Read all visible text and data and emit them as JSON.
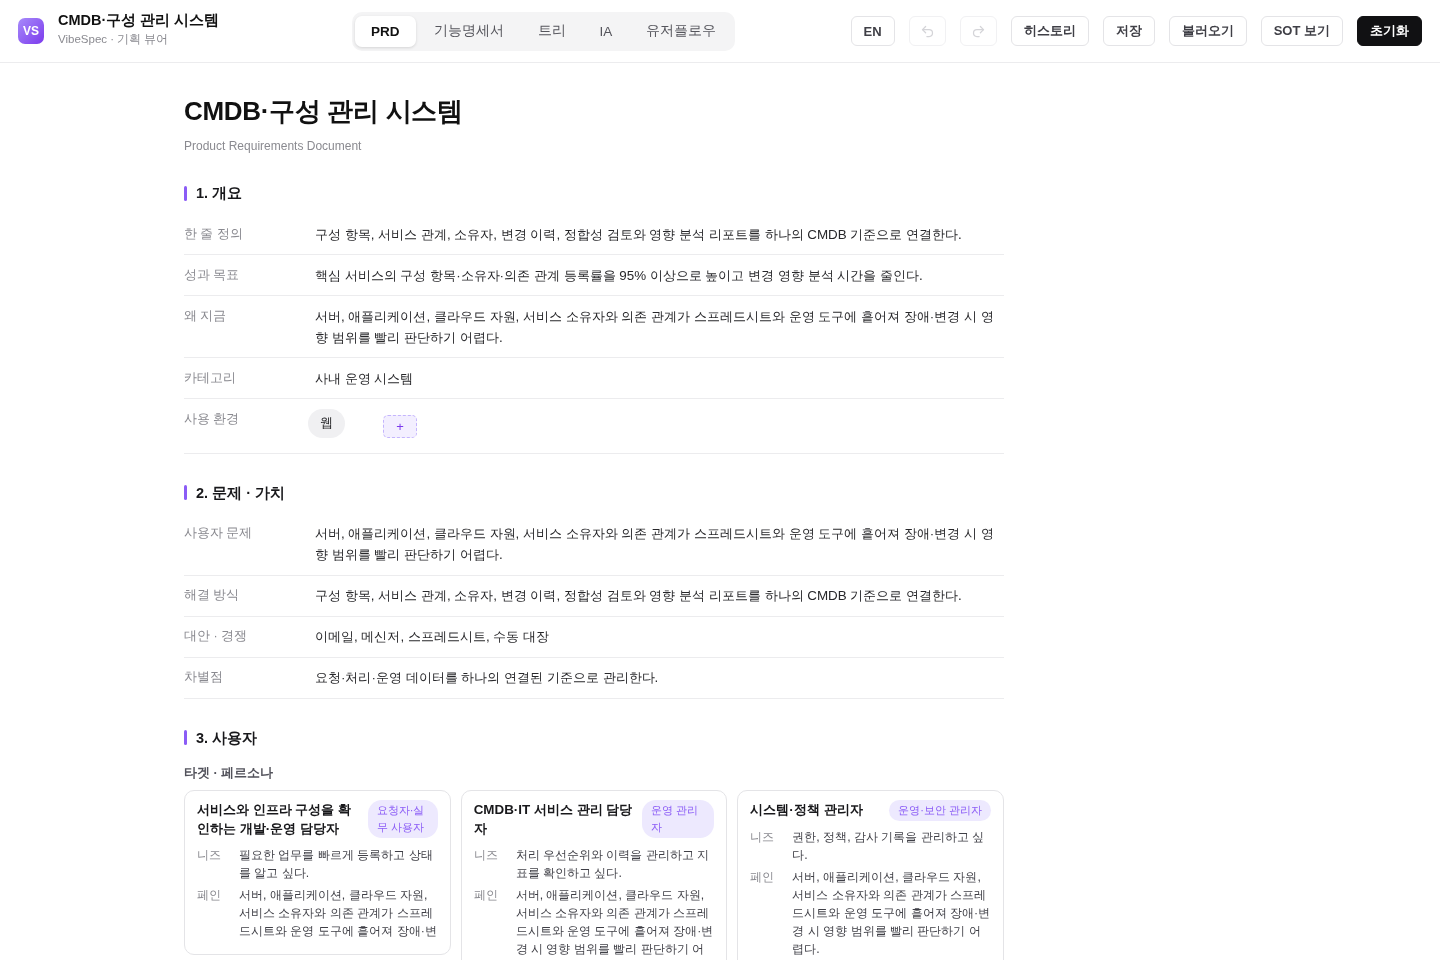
{
  "header": {
    "logo": "VS",
    "title": "CMDB·구성 관리 시스템",
    "subtitle": "VibeSpec · 기획 뷰어"
  },
  "tabs": [
    {
      "label": "PRD",
      "selected": true
    },
    {
      "label": "기능명세서",
      "selected": false
    },
    {
      "label": "트리",
      "selected": false
    },
    {
      "label": "IA",
      "selected": false
    },
    {
      "label": "유저플로우",
      "selected": false
    }
  ],
  "toolbar": [
    {
      "kind": "text",
      "label": "EN",
      "disabled": false
    },
    {
      "kind": "undo",
      "disabled": true
    },
    {
      "kind": "redo",
      "disabled": true
    },
    {
      "kind": "text",
      "label": "히스토리",
      "disabled": false
    },
    {
      "kind": "text",
      "label": "저장",
      "disabled": false
    },
    {
      "kind": "text",
      "label": "불러오기",
      "disabled": false
    },
    {
      "kind": "text",
      "label": "SOT 보기",
      "disabled": false
    },
    {
      "kind": "primary",
      "label": "초기화",
      "disabled": false
    }
  ],
  "document": {
    "title": "CMDB·구성 관리 시스템",
    "subtitle": "Product Requirements Document"
  },
  "sections": [
    {
      "kind": "fields",
      "heading": "1. 개요",
      "rows": [
        {
          "kind": "text",
          "label": "한 줄 정의",
          "value": "구성 항목, 서비스 관계, 소유자, 변경 이력, 정합성 검토와 영향 분석 리포트를 하나의 CMDB 기준으로 연결한다."
        },
        {
          "kind": "text",
          "label": "성과 목표",
          "value": "핵심 서비스의 구성 항목·소유자·의존 관계 등록률을 95% 이상으로 높이고 변경 영향 분석 시간을 줄인다."
        },
        {
          "kind": "text",
          "label": "왜 지금",
          "value": "서버, 애플리케이션, 클라우드 자원, 서비스 소유자와 의존 관계가 스프레드시트와 운영 도구에 흩어져 장애·변경 시 영향 범위를 빨리 판단하기 어렵다."
        },
        {
          "kind": "text",
          "label": "카테고리",
          "value": "사내 운영 시스템"
        },
        {
          "kind": "chips",
          "label": "사용 환경",
          "chips": [
            "웹"
          ],
          "add": "+"
        }
      ]
    },
    {
      "kind": "fields",
      "heading": "2. 문제 · 가치",
      "rows": [
        {
          "kind": "text",
          "label": "사용자 문제",
          "value": "서버, 애플리케이션, 클라우드 자원, 서비스 소유자와 의존 관계가 스프레드시트와 운영 도구에 흩어져 장애·변경 시 영향 범위를 빨리 판단하기 어렵다."
        },
        {
          "kind": "text",
          "label": "해결 방식",
          "value": "구성 항목, 서비스 관계, 소유자, 변경 이력, 정합성 검토와 영향 분석 리포트를 하나의 CMDB 기준으로 연결한다."
        },
        {
          "kind": "text",
          "label": "대안 · 경쟁",
          "value": "이메일, 메신저, 스프레드시트, 수동 대장"
        },
        {
          "kind": "text",
          "label": "차별점",
          "value": "요청·처리·운영 데이터를 하나의 연결된 기준으로 관리한다."
        }
      ]
    },
    {
      "kind": "personas",
      "heading": "3. 사용자",
      "subheading": "타겟 · 페르소나",
      "personas": [
        {
          "name": "서비스와 인프라 구성을 확인하는 개발·운영 담당자",
          "role": "요청자·실무 사용자",
          "needs_label": "니즈",
          "needs": "필요한 업무를 빠르게 등록하고 상태를 알고 싶다.",
          "pain_label": "페인",
          "pain": "서버, 애플리케이션, 클라우드 자원, 서비스 소유자와 의존 관계가 스프레드시트와 운영 도구에 흩어져 장애·변"
        },
        {
          "name": "CMDB·IT 서비스 관리 담당자",
          "role": "운영 관리자",
          "needs_label": "니즈",
          "needs": "처리 우선순위와 이력을 관리하고 지표를 확인하고 싶다.",
          "pain_label": "페인",
          "pain": "서버, 애플리케이션, 클라우드 자원, 서비스 소유자와 의존 관계가 스프레드시트와 운영 도구에 흩어져 장애·변경 시 영향 범위를 빨리 판단하기 어"
        },
        {
          "name": "시스템·정책 관리자",
          "role": "운영·보안 관리자",
          "needs_label": "니즈",
          "needs": "권한, 정책, 감사 기록을 관리하고 싶다.",
          "pain_label": "페인",
          "pain": "서버, 애플리케이션, 클라우드 자원, 서비스 소유자와 의존 관계가 스프레드시트와 운영 도구에 흩어져 장애·변경 시 영향 범위를 빨리 판단하기 어렵다."
        }
      ]
    }
  ]
}
